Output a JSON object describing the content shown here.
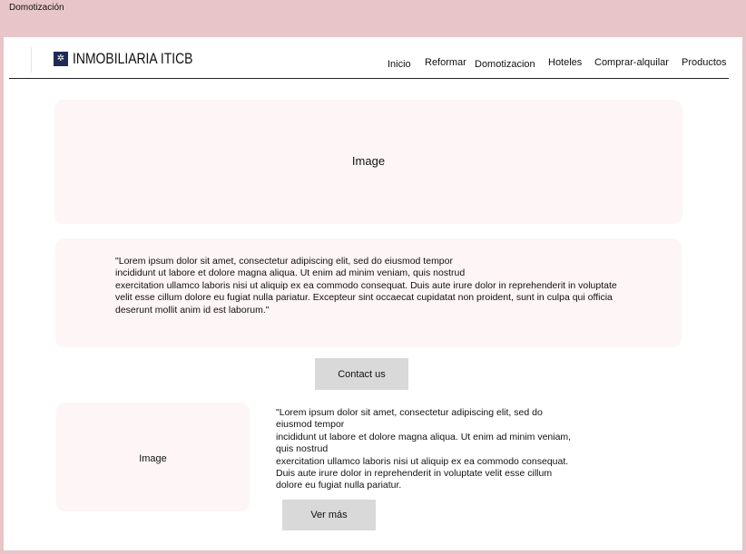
{
  "frame": {
    "title": "Domotización"
  },
  "header": {
    "brand": "INMOBILIARIA ITICB",
    "nav": [
      "Inicio",
      "Reformar",
      "Domotizacion",
      "Hoteles",
      "Comprar-alquilar",
      "Productos"
    ]
  },
  "hero": {
    "label": "Image"
  },
  "intro": {
    "text": "\"Lorem ipsum dolor sit amet, consectetur adipiscing elit, sed do eiusmod tempor\nincididunt ut labore et dolore magna aliqua. Ut enim ad minim veniam, quis nostrud\nexercitation ullamco laboris nisi ut aliquip ex ea commodo consequat. Duis aute irure dolor in reprehenderit in voluptate\nvelit esse cillum dolore eu fugiat nulla pariatur.  Excepteur sint occaecat cupidatat non proident, sunt in culpa qui officia\ndeserunt mollit  anim id est laborum.\""
  },
  "contact_button": {
    "label": "Contact us"
  },
  "feature": {
    "image_label": "Image",
    "text": "\"Lorem ipsum dolor sit amet, consectetur adipiscing elit, sed do\neiusmod tempor\nincididunt ut labore et dolore magna aliqua. Ut enim ad minim veniam,\nquis nostrud\nexercitation ullamco laboris nisi ut aliquip ex ea commodo consequat.\nDuis aute irure dolor in reprehenderit in voluptate velit esse cillum\ndolore eu fugiat nulla pariatur.",
    "more_label": "Ver más"
  },
  "colors": {
    "frame_background": "#e8c5c8",
    "panel": "#fdf5f6",
    "button": "#d9d9d9",
    "logo": "#1f2a55"
  }
}
